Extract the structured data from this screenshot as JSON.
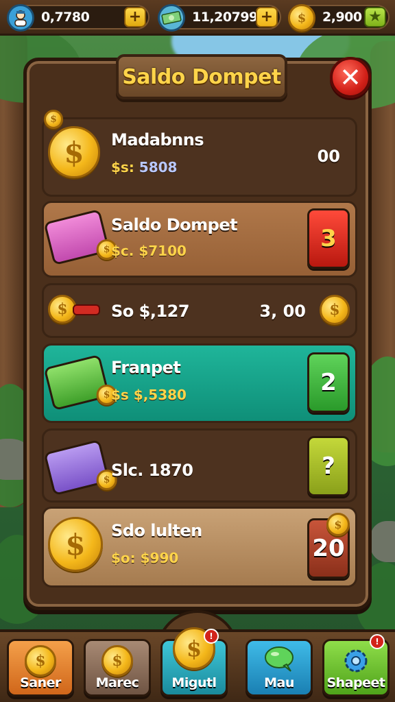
{
  "top_bar": {
    "resources": [
      {
        "name": "players",
        "value": "0,7780",
        "icon": "avatar-icon"
      },
      {
        "name": "cash",
        "value": "11,20799",
        "icon": "cash-stack-icon"
      },
      {
        "name": "coins",
        "value": "2,900",
        "icon": "coin-icon"
      }
    ],
    "plus_glyph": "+",
    "star_glyph": "★"
  },
  "panel": {
    "title": "Saldo Dompet",
    "close_glyph": "✕",
    "rows": [
      {
        "label": "Madabnns",
        "sub_prefix": "$s:",
        "sub_value": "5808",
        "amount": "00",
        "icon": "gold-coin-icon",
        "style": "dark"
      },
      {
        "label": "Saldo Dompet",
        "sub": "$c. $7100",
        "badge": "3",
        "badge_color": "#d8281c",
        "icon": "pink-wallet-icon",
        "style": "tan"
      },
      {
        "label": "So $,127",
        "amount": "3, 00",
        "icon": "coin-slider-icon",
        "style": "dark"
      },
      {
        "label": "Franpet",
        "sub": "$s $,5380",
        "badge": "2",
        "badge_color": "#3aae3a",
        "icon": "green-cash-icon",
        "style": "teal"
      },
      {
        "label": "Slc. 1870",
        "badge": "?",
        "badge_color": "#9ab82a",
        "icon": "purple-wallet-icon",
        "style": "dark"
      },
      {
        "label": "Sdo lulten",
        "sub": "$o: $990",
        "badge": "20",
        "badge_color": "#a8452a",
        "icon": "gold-coin-icon",
        "style": "light"
      }
    ]
  },
  "bottom_nav": [
    {
      "label": "Saner",
      "icon": "coin-icon",
      "color": "#e9822a"
    },
    {
      "label": "Marec",
      "icon": "coin-icon",
      "color": "#8c6b55"
    },
    {
      "label": "Migutl",
      "icon": "coin-icon",
      "color": "#2aa3b5"
    },
    {
      "label": "Mau",
      "icon": "chat-bubble-icon",
      "color": "#2b9fd0"
    },
    {
      "label": "Shapeet",
      "icon": "gear-icon",
      "color": "#6cc23a"
    }
  ]
}
